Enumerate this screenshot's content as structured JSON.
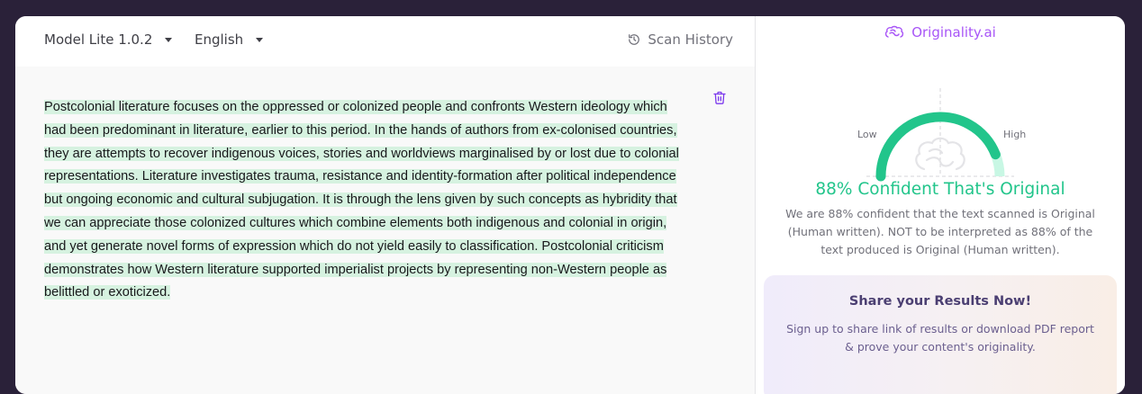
{
  "toolbar": {
    "model_label": "Model Lite 1.0.2",
    "language_label": "English",
    "scan_history_label": "Scan History"
  },
  "editor": {
    "lines": [
      "Postcolonial literature focuses on the oppressed or colonized people and confronts Western ideology which",
      "had been predominant in literature, earlier to this period. In the hands of authors from ex-colonised countries,",
      "they are attempts to recover indigenous voices, stories and worldviews marginalised by or lost due to colonial",
      "representations. Literature investigates trauma, resistance and identity-formation after political independence",
      "but ongoing economic and cultural subjugation. It is through the lens given by such concepts as hybridity that",
      "we can appreciate those colonized cultures which combine elements both indigenous and colonial in origin,",
      "and yet generate novel forms of expression which do not yield easily to classification. Postcolonial criticism",
      "demonstrates how Western literature supported imperialist projects by representing non-Western people as",
      "belittled or exoticized."
    ],
    "highlight_color": "#d6f2e0"
  },
  "brand": {
    "name": "Originality.ai",
    "color": "#a855f7"
  },
  "result": {
    "confidence_percent": 88,
    "low_label": "Low",
    "high_label": "High",
    "title": "88% Confident That's Original",
    "description": "We are 88% confident that the text scanned is Original (Human written). NOT to be interpreted as 88% of the text produced is Original (Human written).",
    "gauge_color": "#22c58b",
    "gauge_remainder_color": "#c8f7e4"
  },
  "share": {
    "title": "Share your Results Now!",
    "description": "Sign up to share link of results or download PDF report & prove your content's originality."
  }
}
